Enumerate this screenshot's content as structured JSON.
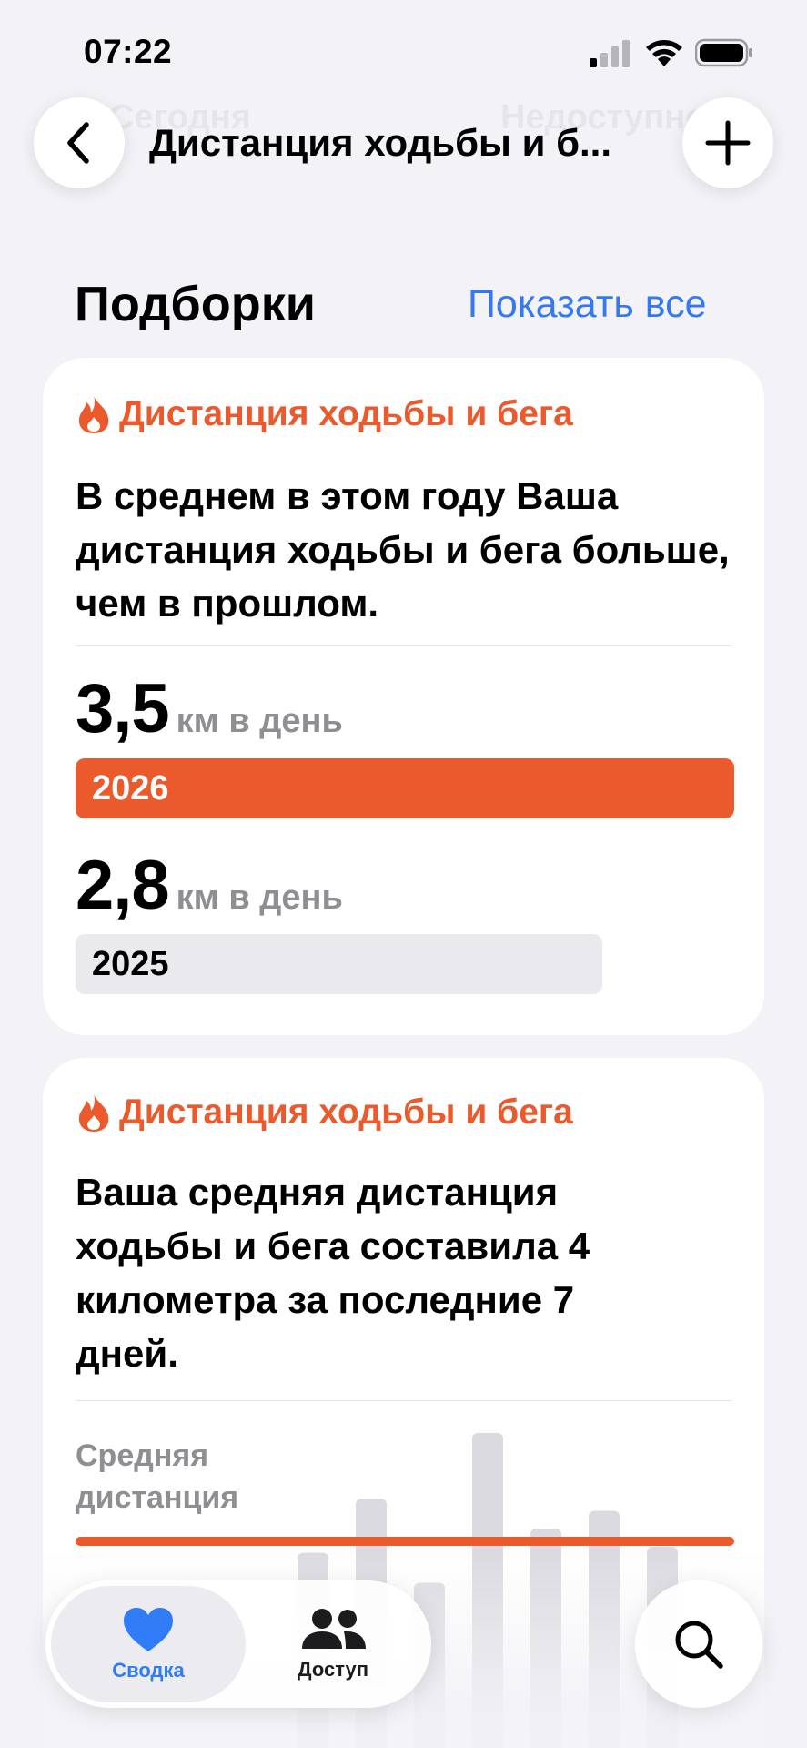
{
  "status_bar": {
    "time": "07:22"
  },
  "nav": {
    "title": "Дистанция ходьбы и б...",
    "back_icon": "chevron-left-icon",
    "add_icon": "plus-icon",
    "ghost_left": "Сегодня",
    "ghost_right": "Недоступно"
  },
  "section": {
    "title": "Подборки",
    "show_all": "Показать все"
  },
  "cards": [
    {
      "category": "Дистанция ходьбы и бега",
      "icon": "flame-icon",
      "text": "В среднем в этом году Ваша дистанция ходьбы и бега больше, чем в прошлом.",
      "current": {
        "value": "3,5",
        "unit": "км в день",
        "year": "2026"
      },
      "previous": {
        "value": "2,8",
        "unit": "км в день",
        "year": "2025",
        "fraction_of_current": 0.8
      }
    },
    {
      "category": "Дистанция ходьбы и бега",
      "icon": "flame-icon",
      "text": "Ваша средняя дистанция ходьбы и бега составила 4 километра за последние 7 дней.",
      "avg_label": "Средняя дистанция",
      "avg_value": "4",
      "chart_values": [
        4.2,
        5.1,
        3.7,
        6.2,
        4.6,
        4.9,
        4.3
      ]
    }
  ],
  "tabs": [
    {
      "label": "Сводка",
      "icon": "heart-icon",
      "active": true
    },
    {
      "label": "Доступ",
      "icon": "people-icon",
      "active": false
    }
  ],
  "search_icon": "search-icon",
  "colors": {
    "accent": "#eb5a2c",
    "link": "#3478f6",
    "tab_active": "#2f7cf6"
  }
}
